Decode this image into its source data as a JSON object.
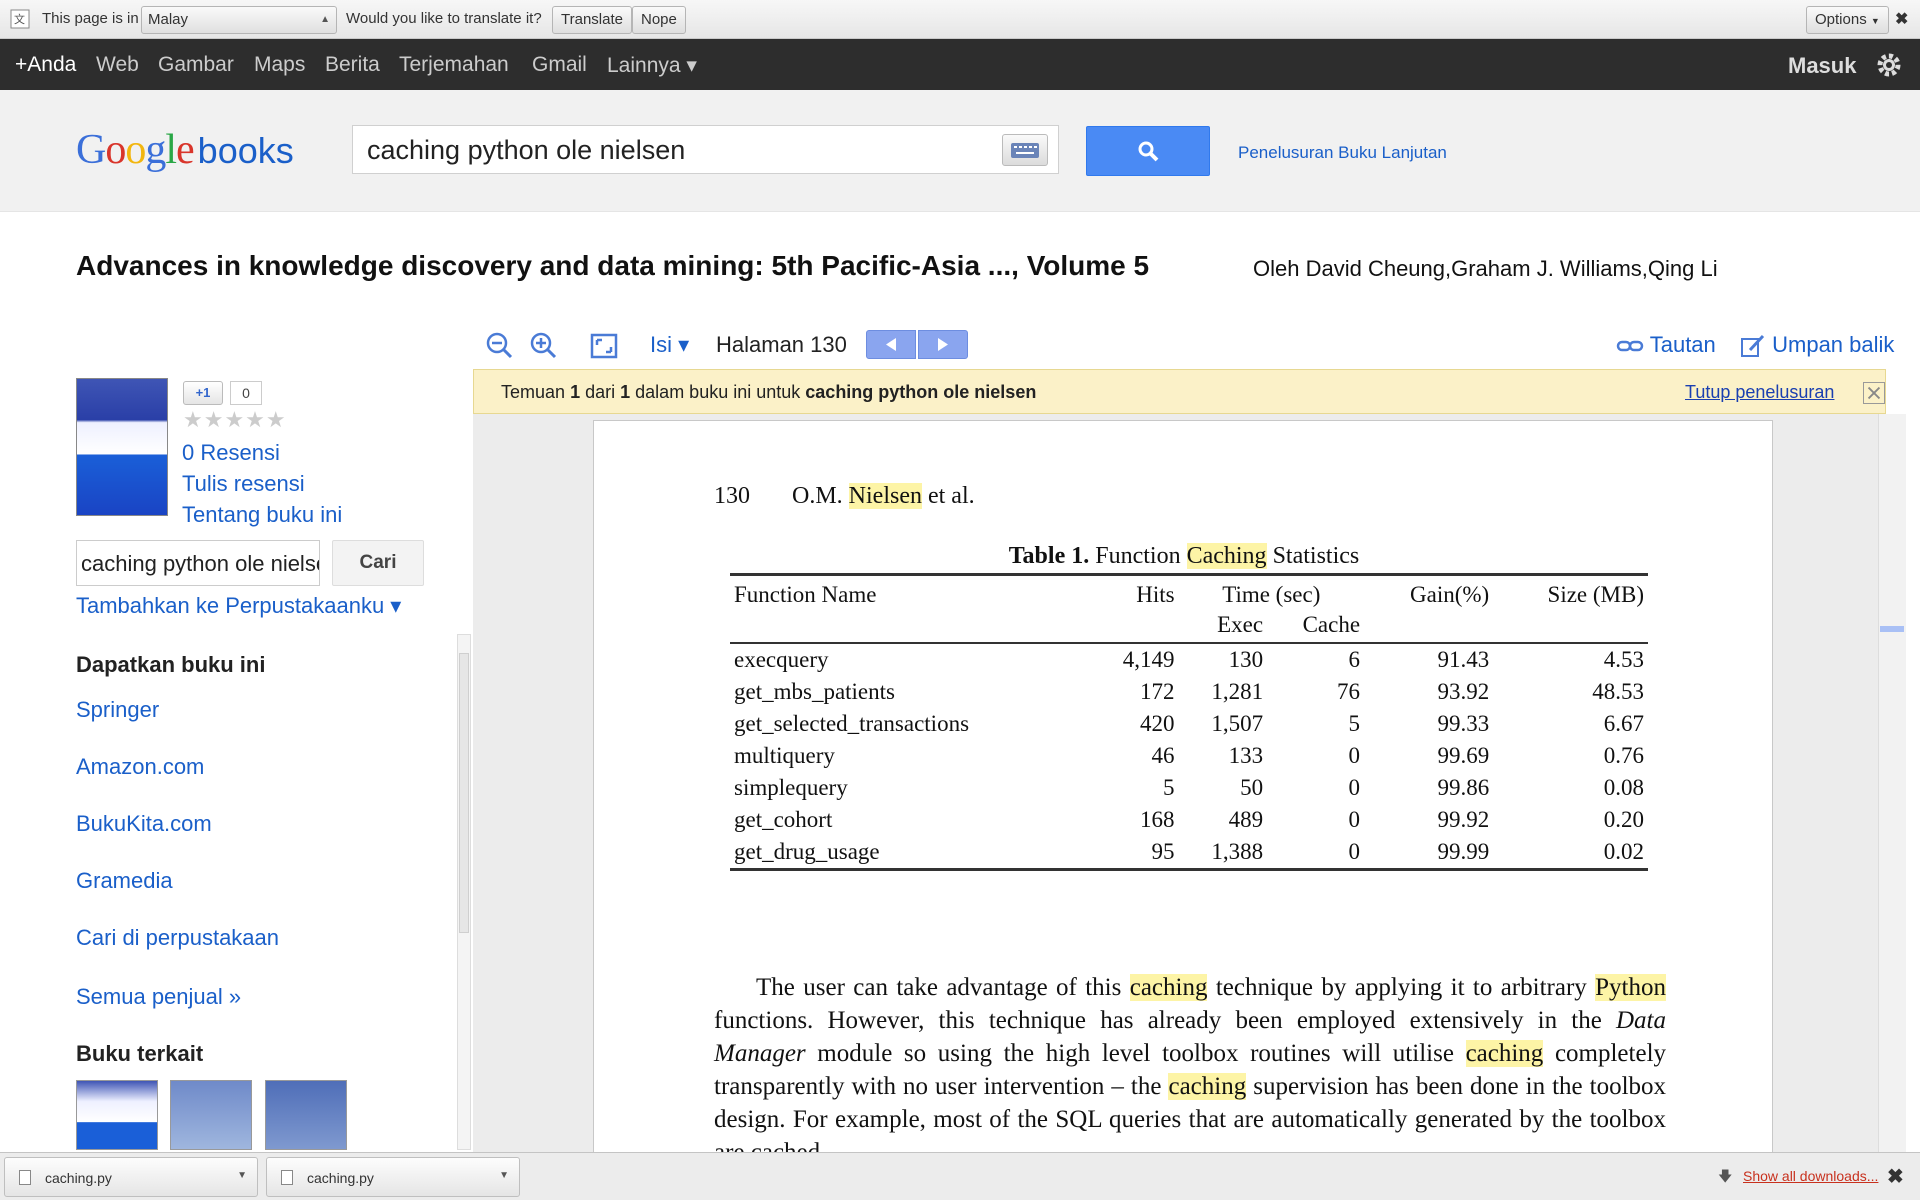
{
  "translate_bar": {
    "prompt": "This page is in",
    "language": "Malay",
    "question": "Would you like to translate it?",
    "translate_label": "Translate",
    "nope_label": "Nope",
    "options_label": "Options",
    "close_glyph": "✖"
  },
  "topnav": {
    "items": [
      "+Anda",
      "Web",
      "Gambar",
      "Maps",
      "Berita",
      "Terjemahan",
      "Gmail",
      "Lainnya ▾"
    ],
    "signin": "Masuk"
  },
  "header": {
    "logo_books": "books",
    "search_value": "caching python ole nielsen",
    "advanced_search": "Penelusuran Buku Lanjutan"
  },
  "book": {
    "title": "Advances in knowledge discovery and data mining: 5th Pacific-Asia ..., Volume 5",
    "authors": "Oleh David Cheung,Graham J. Williams,Qing Li"
  },
  "sidebar": {
    "plus_one": "+1",
    "plus_one_count": "0",
    "stars": "★★★★★",
    "reviews": "0 Resensi",
    "write_review": "Tulis resensi",
    "about": "Tentang buku ini",
    "search_value": "caching python ole nielsen",
    "search_button": "Cari",
    "add_library": "Tambahkan ke Perpustakaanku ▾",
    "get_heading": "Dapatkan buku ini",
    "sellers": [
      "Springer",
      "Amazon.com",
      "BukuKita.com",
      "Gramedia",
      "Cari di perpustakaan",
      "Semua penjual »"
    ],
    "related_heading": "Buku terkait"
  },
  "toolbar": {
    "contents": "Isi ▾",
    "page": "Halaman 130",
    "link": "Tautan",
    "feedback": "Umpan balik"
  },
  "result_banner": {
    "prefix": "Temuan",
    "n": "1",
    "of": "dari",
    "total": "1",
    "middle": "dalam buku ini untuk",
    "query": "caching python ole nielsen",
    "close_search": "Tutup penelusuran"
  },
  "page": {
    "number": "130",
    "author_prefix": "O.M.",
    "author_hl": "Nielsen",
    "author_suffix": "et al.",
    "caption_bold": "Table 1.",
    "caption_pre": "Function",
    "caption_hl": "Caching",
    "caption_post": "Statistics",
    "columns": [
      "Function Name",
      "Hits",
      "Time (sec)",
      "Gain(%)",
      "Size (MB)"
    ],
    "subcolumns": [
      "Exec",
      "Cache"
    ],
    "rows": [
      [
        "execquery",
        "4,149",
        "130",
        "6",
        "91.43",
        "4.53"
      ],
      [
        "get_mbs_patients",
        "172",
        "1,281",
        "76",
        "93.92",
        "48.53"
      ],
      [
        "get_selected_transactions",
        "420",
        "1,507",
        "5",
        "99.33",
        "6.67"
      ],
      [
        "multiquery",
        "46",
        "133",
        "0",
        "99.69",
        "0.76"
      ],
      [
        "simplequery",
        "5",
        "50",
        "0",
        "99.86",
        "0.08"
      ],
      [
        "get_cohort",
        "168",
        "489",
        "0",
        "99.92",
        "0.20"
      ],
      [
        "get_drug_usage",
        "95",
        "1,388",
        "0",
        "99.99",
        "0.02"
      ]
    ],
    "p1": "The user can take advantage of this",
    "h1": "caching",
    "p2": "technique by applying it to arbitrary",
    "h2": "Python",
    "p3": "functions. However, this technique has already been employed extensively in the",
    "p3_em": "Data Manager",
    "p4": "module so using the high level toolbox routines will utilise",
    "h3": "caching",
    "p5": "completely transparently with no user intervention – the",
    "h4": "caching",
    "p6": "supervision has been done in the toolbox design. For example, most of the SQL queries that are automatically generated by the toolbox are cached"
  },
  "downloads": {
    "files": [
      "caching.py",
      "caching.py"
    ],
    "show_all": "Show all downloads...",
    "close_glyph": "✖"
  },
  "colors": {
    "accent_link": "#1a5fc9",
    "highlight": "#fdf4a6",
    "banner": "#fbf1c8",
    "nav_bg": "#2d2d2d",
    "search_btn": "#4a8af4"
  }
}
